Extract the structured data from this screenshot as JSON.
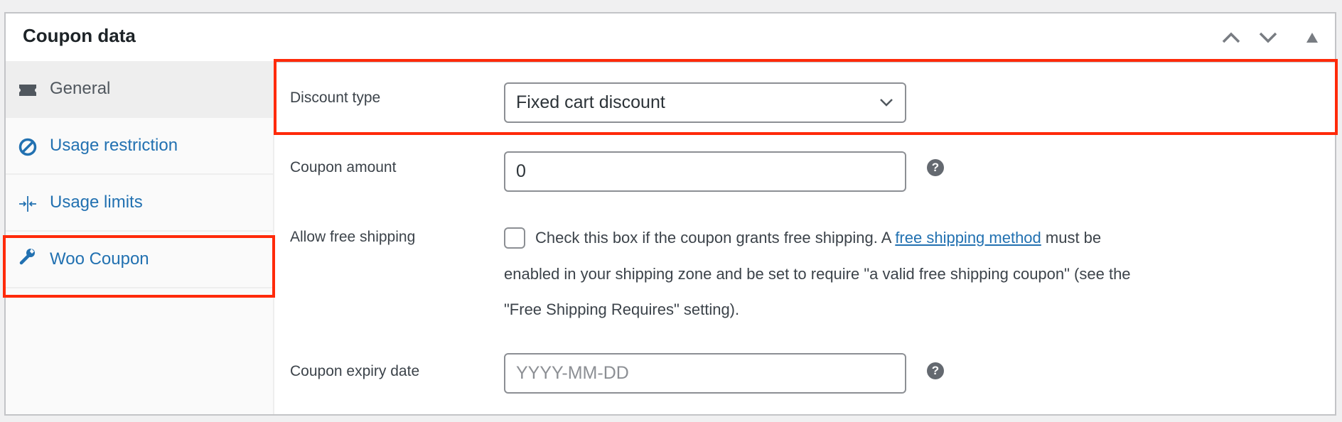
{
  "header": {
    "title": "Coupon data",
    "move_up_icon": "chevron-up-icon",
    "move_down_icon": "chevron-down-icon",
    "toggle_icon": "triangle-up-icon"
  },
  "sidebar": {
    "items": [
      {
        "label": "General",
        "icon": "ticket-icon",
        "active": true
      },
      {
        "label": "Usage restriction",
        "icon": "ban-icon",
        "active": false
      },
      {
        "label": "Usage limits",
        "icon": "collapse-arrows-icon",
        "active": false
      },
      {
        "label": "Woo Coupon",
        "icon": "wrench-icon",
        "active": false
      }
    ]
  },
  "form": {
    "discount_type": {
      "label": "Discount type",
      "value": "Fixed cart discount"
    },
    "coupon_amount": {
      "label": "Coupon amount",
      "value": "0"
    },
    "free_shipping": {
      "label": "Allow free shipping",
      "checked": false,
      "text_before": "Check this box if the coupon grants free shipping. A ",
      "link": "free shipping method",
      "text_after": " must be",
      "line2": "enabled in your shipping zone and be set to require \"a valid free shipping coupon\" (see the",
      "line3": "\"Free Shipping Requires\" setting)."
    },
    "expiry_date": {
      "label": "Coupon expiry date",
      "placeholder": "YYYY-MM-DD"
    },
    "help_icon": "?"
  },
  "colors": {
    "highlight": "#ff2a0a",
    "link": "#2271b1"
  }
}
